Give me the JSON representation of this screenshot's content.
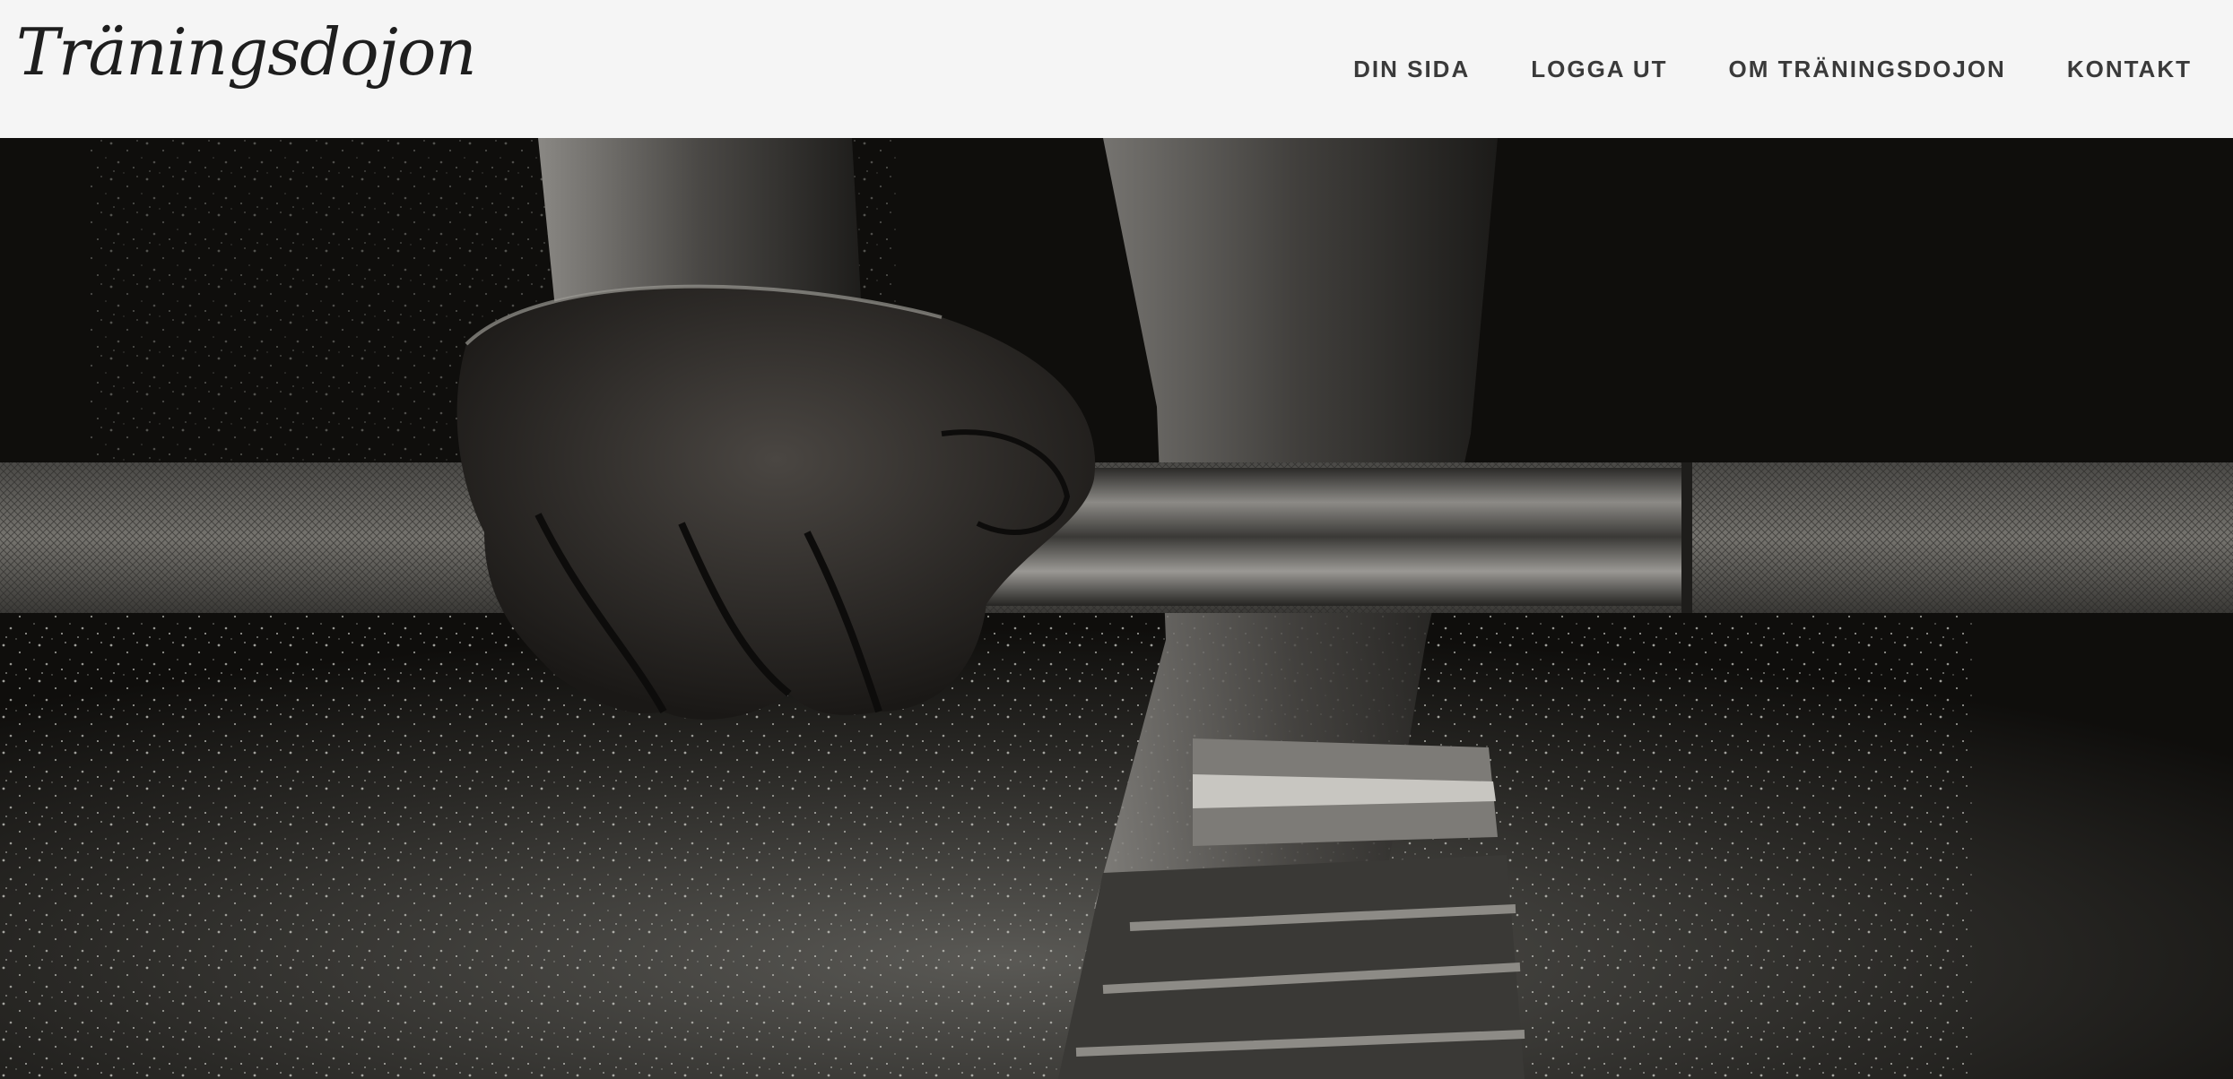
{
  "brand": {
    "logo_text": "Träningsdojon"
  },
  "nav": {
    "items": [
      {
        "label": "DIN SIDA"
      },
      {
        "label": "LOGGA UT"
      },
      {
        "label": "OM TRÄNINGSDOJON"
      },
      {
        "label": "KONTAKT"
      }
    ]
  },
  "hero": {
    "image": "barbell-grip-chalk-photo-icon"
  },
  "colors": {
    "header_bg": "#f5f5f5",
    "nav_text": "#3a3a3a",
    "hero_bg": "#0f0e0c"
  }
}
